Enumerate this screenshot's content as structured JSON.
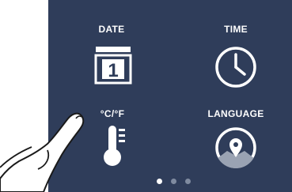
{
  "settings": {
    "date": {
      "label": "DATE",
      "calendar_day": "1",
      "icon": "calendar-icon"
    },
    "time": {
      "label": "TIME",
      "icon": "clock-icon"
    },
    "units": {
      "label": "°C/°F",
      "icon": "thermometer-icon"
    },
    "language": {
      "label": "LANGUAGE",
      "icon": "location-pin-icon"
    }
  },
  "pager": {
    "page_count": 3,
    "current_page": 1
  },
  "colors": {
    "panel": "#2f3d5a",
    "icon": "#ffffff",
    "dot_inactive": "#7f8ba0"
  }
}
